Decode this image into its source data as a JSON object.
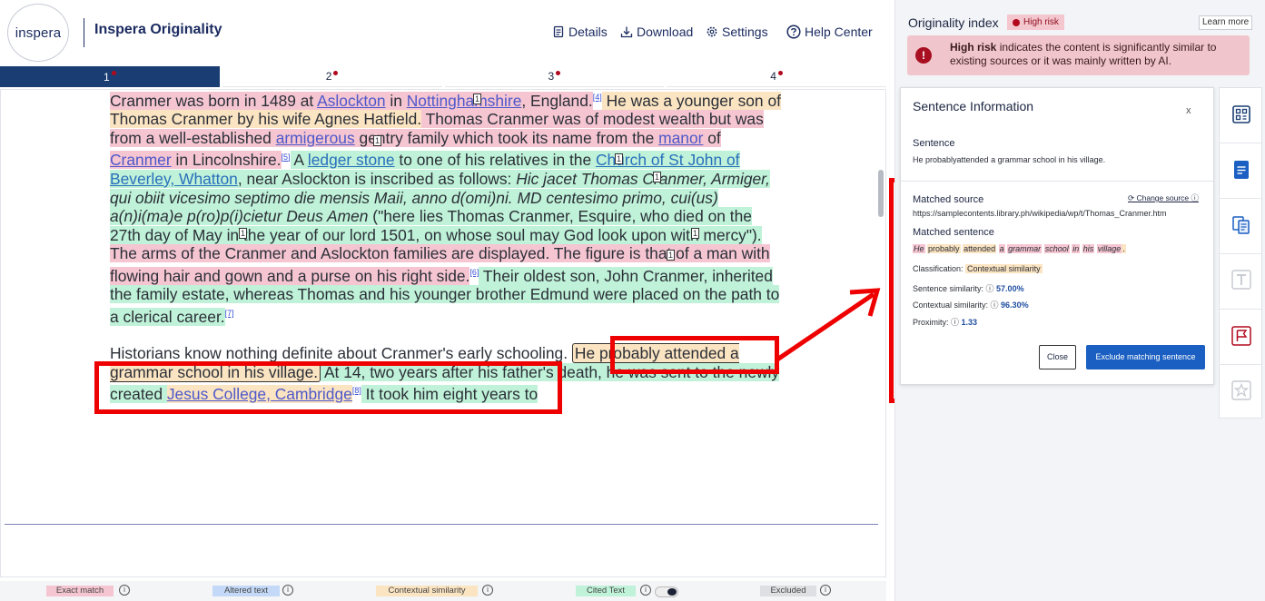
{
  "header": {
    "logo_text": "inspera",
    "app_title": "Inspera Originality",
    "nav": {
      "details": "Details",
      "download": "Download",
      "settings": "Settings",
      "help": "Help Center"
    }
  },
  "tabs": [
    "1",
    "2",
    "3",
    "4"
  ],
  "document": {
    "p1": {
      "s1": "Cranmer was born in 1489 at ",
      "l1": "Aslockton",
      "s2": " in ",
      "l2": "Nottinghamshire",
      "s3": ", England.",
      "c1": "[4]",
      "s4": " He was a younger son of Thomas Cranmer by his wife Agnes Hatfield.",
      "s5": " Thomas Cranmer was of modest wealth but was from a well-established ",
      "l3": "armigerous",
      "s6": " gentry family which took its name from the ",
      "l4": "manor",
      "s7": " of ",
      "l5": "Cranmer",
      "s8": " in Lincolnshire.",
      "c2": "[5]",
      "s9": " A ",
      "l6": "ledger stone",
      "s10": " to one of his relatives in the ",
      "l7": "Church of St John of Beverley, Whatton",
      "s11": ", near Aslockton is inscribed as follows: ",
      "i1": "Hic jacet Thomas Cranmer, Armiger, qui obiit vicesimo septimo die mensis Maii, anno d(omi)ni. MD centesimo primo, cui(us) a(n)i(ma)e p(ro)p(i)cietur Deus Amen",
      "s12": " (\"here lies Thomas Cranmer, Esquire, who died on the 27th day of May in the year of our lord 1501, on whose soul may God look upon with mercy\").",
      "s13": " The arms of the Cranmer and Aslockton",
      "s14": " families are displayed. The figure is that of a man with flowing hair and gown and a purse on his right side.",
      "c3": "[6]",
      "s15": " Their oldest son, John Cranmer, inherited the family estate, whereas Thomas and his younger brother Edmund were placed on the path to a clerical career.",
      "c4": "[7]"
    },
    "p2": {
      "s1": "Historians know nothing definite about Cranmer's early schooling.",
      "s2": "He probably attended a grammar school in his village.",
      "s3": " At 14, two years after his father's death, he was sent to the newly created ",
      "l1": "Jesus College, Cambridge",
      "c1": "[8]",
      "s4": " It took him eight years to"
    },
    "marker": "1"
  },
  "legend": {
    "exact": "Exact match",
    "altered": "Altered text",
    "contextual": "Contextual similarity",
    "cited": "Cited Text",
    "excluded": "Excluded",
    "info": "i"
  },
  "right": {
    "title": "Originality index",
    "risk": "High risk",
    "learn": "Learn more",
    "alert_bold": "High risk",
    "alert_text": " indicates the content is significantly similar to existing sources or it was mainly written by AI."
  },
  "panel": {
    "title": "Sentence Information",
    "close_x": "x",
    "sentence_label": "Sentence",
    "sentence": "He probablyattended a grammar school in his village.",
    "matched_source_label": "Matched source",
    "change_source": "Change source",
    "url": "https://samplecontents.library.ph/wikipedia/wp/t/Thomas_Cranmer.htm",
    "matched_sentence_label": "Matched sentence",
    "matched_words": [
      "He",
      "probably",
      "attended",
      "a",
      "grammar",
      "school",
      "in",
      "his",
      "village",
      "."
    ],
    "classification_label": "Classification:",
    "classification": "Contextual similarity",
    "sentence_sim_label": "Sentence similarity:",
    "sentence_sim": "57.00%",
    "contextual_sim_label": "Contextual similarity:",
    "contextual_sim": "96.30%",
    "proximity_label": "Proximity:",
    "proximity": "1.33",
    "close_btn": "Close",
    "exclude_btn": "Exclude matching sentence"
  },
  "colors": {
    "exact": "#f5c6d2",
    "altered": "#c3d9f7",
    "contextual": "#fbe4c2",
    "cited": "#bff2d8",
    "excluded": "#dedfe3",
    "accent": "#1a5fc1",
    "risk": "#b2081d"
  }
}
